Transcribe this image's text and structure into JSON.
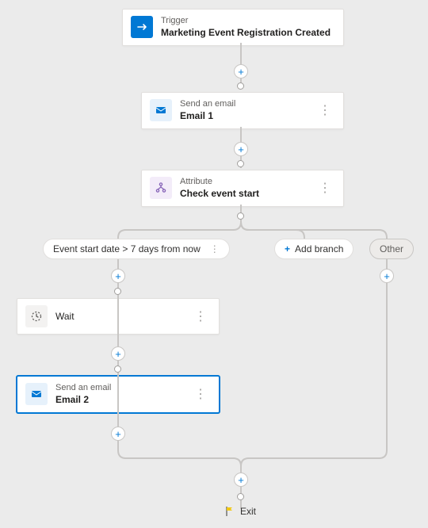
{
  "trigger": {
    "type_label": "Trigger",
    "title": "Marketing Event Registration Created",
    "icon": "trigger"
  },
  "email1": {
    "type_label": "Send an email",
    "title": "Email 1",
    "icon": "email"
  },
  "attribute": {
    "type_label": "Attribute",
    "title": "Check event start",
    "icon": "attribute"
  },
  "branches": {
    "condition": {
      "label": "Event start date > 7 days from now"
    },
    "add_branch_label": "Add branch",
    "other_label": "Other"
  },
  "wait": {
    "title": "Wait",
    "icon": "wait"
  },
  "email2": {
    "type_label": "Send an email",
    "title": "Email 2",
    "icon": "email"
  },
  "exit_label": "Exit",
  "colors": {
    "primary": "#0078d4",
    "trigger_bg": "#0078d4",
    "email_bg": "#e6f1fb",
    "attribute_bg": "#f3ecf9",
    "wait_bg": "#f3f2f1"
  }
}
